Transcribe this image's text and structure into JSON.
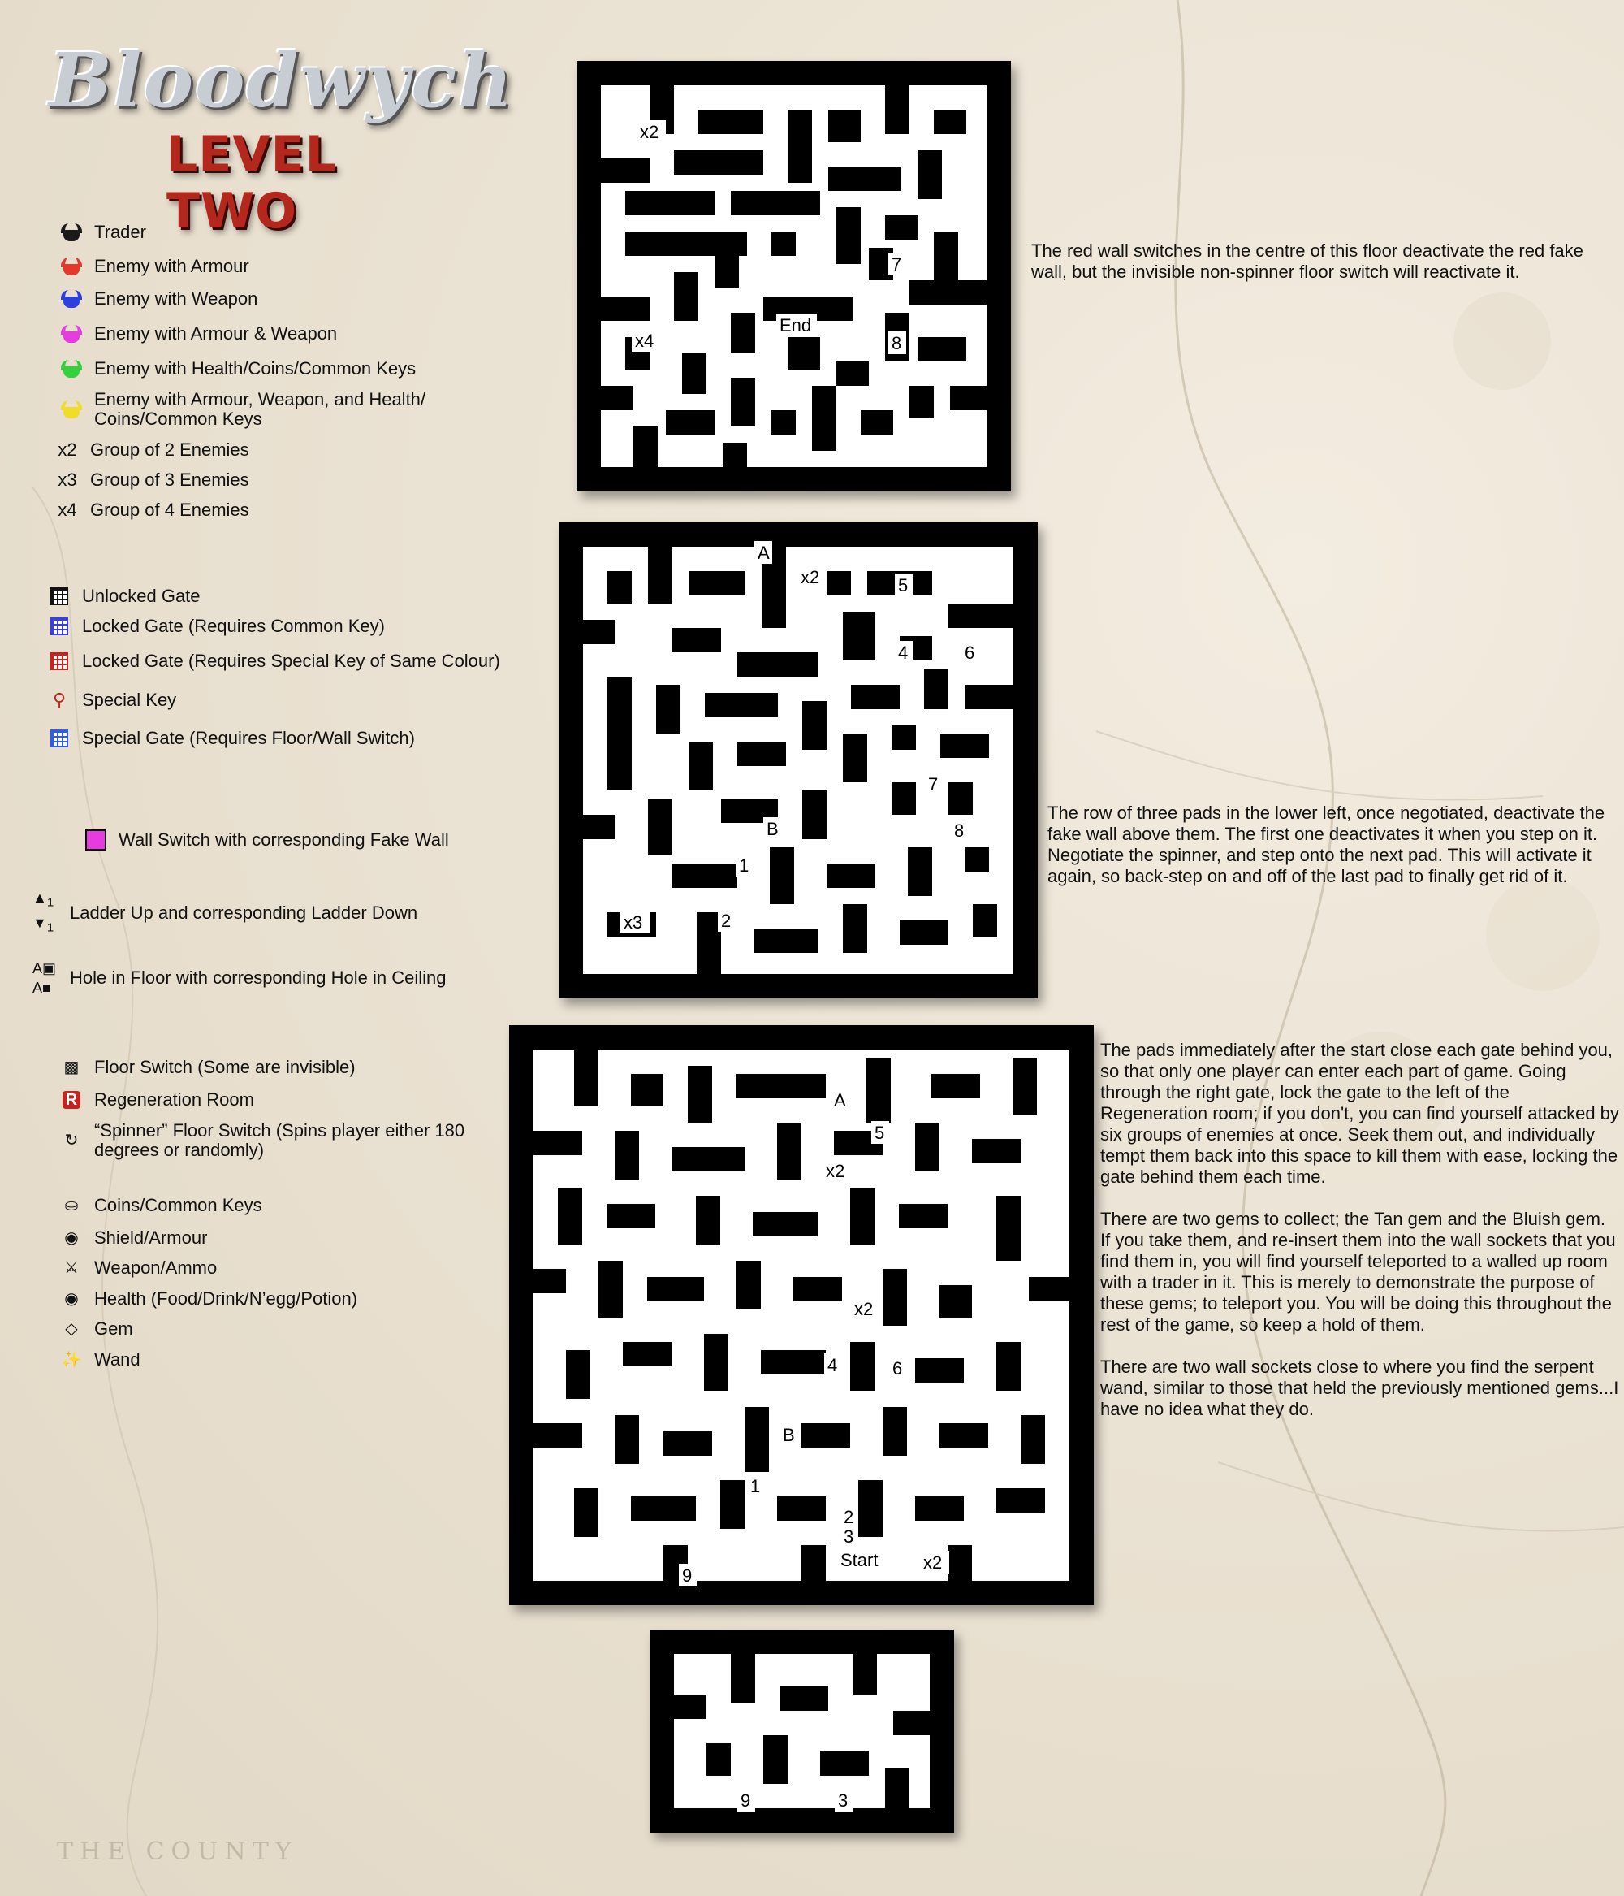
{
  "title": {
    "logo": "Bloodwych",
    "level": "LEVEL TWO"
  },
  "legend": {
    "enemies": [
      {
        "label": "Trader",
        "icon": "horned-helmet-icon",
        "color": "#1a1a1a"
      },
      {
        "label": "Enemy with Armour",
        "icon": "horned-helmet-icon",
        "color": "#e23a2a"
      },
      {
        "label": "Enemy with Weapon",
        "icon": "horned-helmet-icon",
        "color": "#2e3fe0"
      },
      {
        "label": "Enemy with Armour & Weapon",
        "icon": "horned-helmet-icon",
        "color": "#e63be0"
      },
      {
        "label": "Enemy with Health/Coins/Common Keys",
        "icon": "horned-helmet-icon",
        "color": "#33d23a"
      },
      {
        "label": "Enemy with Armour, Weapon, and Health/ Coins/Common Keys",
        "icon": "horned-helmet-icon",
        "color": "#f0dd2a"
      }
    ],
    "groups": [
      {
        "mark": "x2",
        "label": "Group of 2 Enemies"
      },
      {
        "mark": "x3",
        "label": "Group of 3 Enemies"
      },
      {
        "mark": "x4",
        "label": "Group of 4 Enemies"
      }
    ],
    "gates": [
      {
        "label": "Unlocked Gate",
        "icon": "unlocked-gate-icon",
        "color": "#111111"
      },
      {
        "label": "Locked Gate (Requires Common Key)",
        "icon": "locked-gate-icon",
        "color": "#3b3fe0"
      },
      {
        "label": "Locked Gate (Requires Special Key of Same Colour)",
        "icon": "special-locked-gate-icon",
        "color": "#c9221d"
      },
      {
        "label": "Special Key",
        "icon": "special-key-icon",
        "color": "#c9221d"
      },
      {
        "label": "Special Gate (Requires Floor/Wall Switch)",
        "icon": "special-gate-icon",
        "color": "#2d5fe0"
      }
    ],
    "switches": [
      {
        "label": "Wall Switch with corresponding Fake Wall",
        "icon": "wall-switch-icon"
      },
      {
        "label": "Ladder Up and corresponding Ladder Down",
        "icon": "ladder-icon",
        "up_sub": "1",
        "down_sub": "1"
      },
      {
        "label": "Hole in Floor with corresponding Hole in Ceiling",
        "icon": "hole-icon",
        "mark": "A"
      }
    ],
    "items": [
      {
        "label": "Floor Switch (Some are invisible)",
        "icon": "floor-switch-icon"
      },
      {
        "label": "Regeneration Room",
        "icon": "regeneration-icon",
        "mark": "R"
      },
      {
        "label": "“Spinner” Floor Switch (Spins player either 180 degrees or randomly)",
        "icon": "spinner-icon"
      },
      {
        "label": "Coins/Common Keys",
        "icon": "coins-icon"
      },
      {
        "label": "Shield/Armour",
        "icon": "shield-icon"
      },
      {
        "label": "Weapon/Ammo",
        "icon": "sword-icon"
      },
      {
        "label": "Health (Food/Drink/N’egg/Potion)",
        "icon": "health-icon"
      },
      {
        "label": "Gem",
        "icon": "gem-icon"
      },
      {
        "label": "Wand",
        "icon": "wand-icon"
      }
    ]
  },
  "maps": [
    {
      "id": "floor-top",
      "labels": [
        "x2",
        "x4",
        "End",
        "7",
        "8"
      ],
      "description": [
        "The red wall switches in the centre of this floor deactivate the red fake wall, but the invisible non-spinner floor switch will reactivate it."
      ]
    },
    {
      "id": "floor-upper-middle",
      "labels": [
        "A",
        "x2",
        "5",
        "4",
        "6",
        "7",
        "8",
        "B",
        "1",
        "2",
        "x3"
      ],
      "description": [
        "The row of three pads in the lower left, once negotiated, deactivate the fake wall above them. The first one deactivates it when you step on it. Negotiate the spinner, and step onto the next pad. This will activate it again, so back-step on and off of the last pad to finally get rid of it."
      ]
    },
    {
      "id": "floor-lower-middle",
      "labels": [
        "A",
        "5",
        "x2",
        "x2",
        "4",
        "6",
        "B",
        "1",
        "9",
        "2",
        "3",
        "Start",
        "x2"
      ],
      "description": [
        "The pads immediately after the start close each gate behind you, so that only one player can enter each part of game. Going through the right gate, lock the gate to the left of the Regeneration room; if you don't, you can find yourself attacked by six groups of enemies at once. Seek them out, and individually tempt them back into this space to kill them with ease, locking the gate behind them each time.",
        "There are two gems to collect; the Tan gem and the Bluish gem. If you take them, and re-insert them into the wall sockets that you find them in, you will find yourself teleported to a walled up room with a trader in it. This is merely to demonstrate the purpose of these gems; to teleport you. You will be doing this throughout the rest of the game, so keep a hold of them.",
        "There are two wall sockets close to where you find the serpent wand, similar to those that held the previously mentioned gems...I have no idea what they do."
      ]
    },
    {
      "id": "floor-bottom",
      "labels": [
        "9",
        "3"
      ],
      "description": []
    }
  ],
  "footer": {
    "map_text": "THE COUNTY"
  }
}
